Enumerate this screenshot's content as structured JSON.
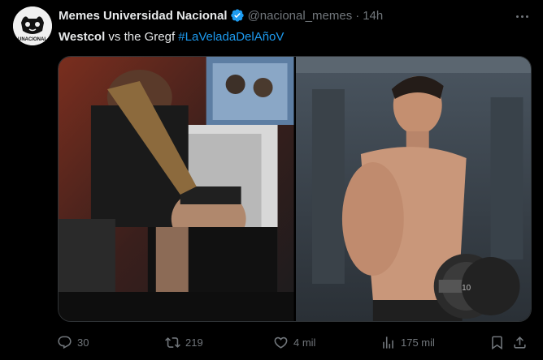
{
  "author": {
    "name": "Memes Universidad Nacional",
    "handle": "@nacional_memes",
    "separator": "·",
    "time": "14h",
    "avatar_text": "UNACIONAL"
  },
  "tweet": {
    "part1": "Westcol",
    "part2": " vs the Gregf ",
    "hashtag": "#LaVeladaDelAñoV"
  },
  "media": {
    "left_icon": "photo-left",
    "right_icon": "photo-right",
    "dumbbell_number": "10"
  },
  "actions": {
    "replies": "30",
    "reposts": "219",
    "likes": "4 mil",
    "views": "175 mil"
  },
  "colors": {
    "background": "#000000",
    "text": "#e7e9ea",
    "muted": "#71767b",
    "accent": "#1d9bf0"
  }
}
